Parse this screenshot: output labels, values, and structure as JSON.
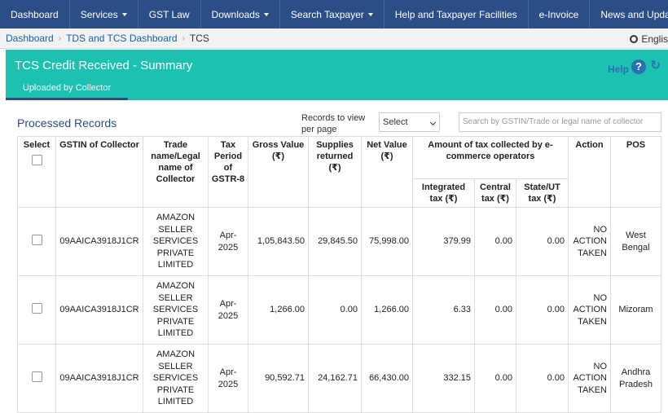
{
  "nav": {
    "items": [
      {
        "label": "Dashboard",
        "caret": false
      },
      {
        "label": "Services",
        "caret": true
      },
      {
        "label": "GST Law",
        "caret": false
      },
      {
        "label": "Downloads",
        "caret": true
      },
      {
        "label": "Search Taxpayer",
        "caret": true
      },
      {
        "label": "Help and Taxpayer Facilities",
        "caret": false
      },
      {
        "label": "e-Invoice",
        "caret": false
      },
      {
        "label": "News and Updates",
        "caret": false
      }
    ]
  },
  "breadcrumb": {
    "items": [
      "Dashboard",
      "TDS and TCS Dashboard",
      "TCS"
    ],
    "language": "Englis"
  },
  "header": {
    "title": "TCS Credit Received - Summary",
    "help_label": "Help",
    "tab_label": "Uploaded by Collector"
  },
  "controls": {
    "section_title": "Processed Records",
    "records_label": "Records to view per page",
    "select_value": "Select",
    "search_placeholder": "Search by GSTIN/Trade or legal name of collector"
  },
  "table": {
    "headers": {
      "select": "Select",
      "gstin": "GSTIN of Collector",
      "trade": "Trade name/Legal name of Collector",
      "period": "Tax Period of GSTR-8",
      "gross": "Gross Value (₹)",
      "supplies": "Supplies returned (₹)",
      "net": "Net Value (₹)",
      "amount_group": "Amount of tax collected by e-commerce operators",
      "igst": "Integrated tax (₹)",
      "cgst": "Central tax (₹)",
      "sgst": "State/UT tax (₹)",
      "action": "Action",
      "pos": "POS"
    },
    "rows": [
      {
        "gstin": "09AAICA3918J1CR",
        "trade": "AMAZON SELLER SERVICES PRIVATE LIMITED",
        "period": "Apr-2025",
        "gross": "1,05,843.50",
        "supplies": "29,845.50",
        "net": "75,998.00",
        "igst": "379.99",
        "cgst": "0.00",
        "sgst": "0.00",
        "action": "NO ACTION TAKEN",
        "pos": "West Bengal"
      },
      {
        "gstin": "09AAICA3918J1CR",
        "trade": "AMAZON SELLER SERVICES PRIVATE LIMITED",
        "period": "Apr-2025",
        "gross": "1,266.00",
        "supplies": "0.00",
        "net": "1,266.00",
        "igst": "6.33",
        "cgst": "0.00",
        "sgst": "0.00",
        "action": "NO ACTION TAKEN",
        "pos": "Mizoram"
      },
      {
        "gstin": "09AAICA3918J1CR",
        "trade": "AMAZON SELLER SERVICES PRIVATE LIMITED",
        "period": "Apr-2025",
        "gross": "90,592.71",
        "supplies": "24,162.71",
        "net": "66,430.00",
        "igst": "332.15",
        "cgst": "0.00",
        "sgst": "0.00",
        "action": "NO ACTION TAKEN",
        "pos": "Andhra Pradesh"
      }
    ]
  },
  "colors": {
    "nav": "#2c4e86",
    "header": "#1cc1b2",
    "link": "#1a5fa3",
    "help": "#2a6fb4"
  },
  "icons": {
    "help": "question-circle-icon",
    "refresh": "refresh-icon",
    "language": "globe-icon",
    "dropdown": "chevron-down-icon"
  }
}
